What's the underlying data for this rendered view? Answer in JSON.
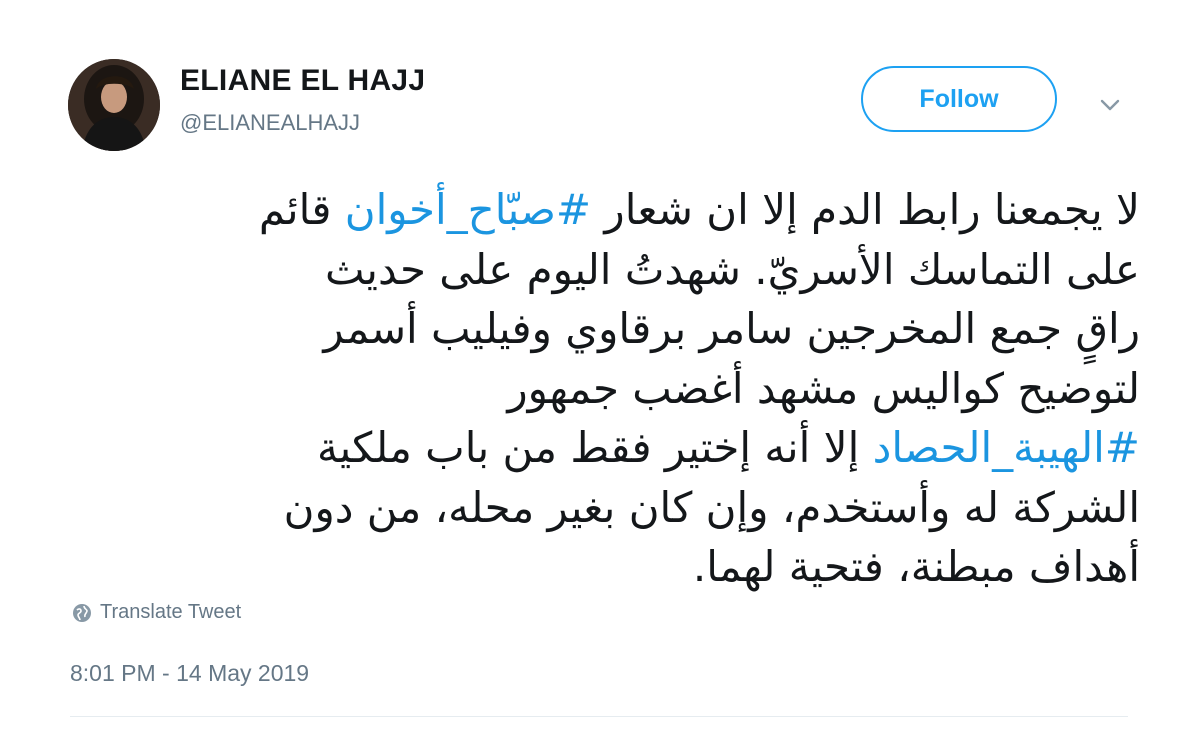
{
  "author": {
    "display_name": "ELIANE EL HAJJ",
    "handle": "@ELIANEALHAJJ"
  },
  "actions": {
    "follow_label": "Follow"
  },
  "tweet": {
    "lines": [
      [
        {
          "text": "لا يجمعنا رابط الدم إلا ان شعار ",
          "link": false
        },
        {
          "text": "#صبّاح_أخوان",
          "link": true
        },
        {
          "text": " قائم",
          "link": false
        }
      ],
      [
        {
          "text": "على التماسك الأسريّ. شهدتُ اليوم على حديث",
          "link": false
        }
      ],
      [
        {
          "text": "راقٍ جمع المخرجين سامر برقاوي وفيليب أسمر",
          "link": false
        }
      ],
      [
        {
          "text": "لتوضيح كواليس مشهد أغضب جمهور",
          "link": false
        }
      ],
      [
        {
          "text": "#الهيبة_الحصاد",
          "link": true
        },
        {
          "text": " إلا أنه إختير فقط من باب ملكية",
          "link": false
        }
      ],
      [
        {
          "text": "الشركة له وأستخدم، وإن كان بغير محله، من دون",
          "link": false
        }
      ],
      [
        {
          "text": "أهداف مبطنة، فتحية لهما.",
          "link": false
        }
      ]
    ],
    "translate_label": "Translate Tweet",
    "timestamp": "8:01 PM - 14 May 2019"
  },
  "icons": {
    "dropdown": "chevron-down-icon",
    "translate": "globe-icon"
  },
  "colors": {
    "accent": "#1da1f2",
    "hashtag": "#1b95e0",
    "text": "#14171a",
    "muted": "#657786",
    "divider": "#e6ecf0"
  }
}
